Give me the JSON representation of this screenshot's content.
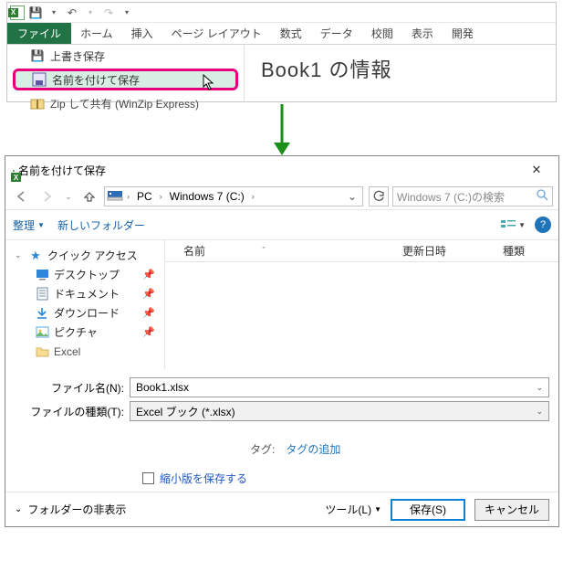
{
  "ribbon": {
    "tabs": {
      "file": "ファイル",
      "home": "ホーム",
      "insert": "挿入",
      "pagelayout": "ページ レイアウト",
      "formulas": "数式",
      "data": "データ",
      "review": "校閲",
      "view": "表示",
      "developer": "開発"
    }
  },
  "backstage": {
    "overwrite": "上書き保存",
    "saveas": "名前を付けて保存",
    "zip": "Zip して共有 (WinZip Express)",
    "info_title": "Book1 の情報"
  },
  "dialog": {
    "title": "名前を付けて保存",
    "breadcrumb": {
      "pc": "PC",
      "drive": "Windows 7 (C:)"
    },
    "search_placeholder": "Windows 7 (C:)の検索",
    "toolbar": {
      "organize": "整理",
      "newfolder": "新しいフォルダー"
    },
    "columns": {
      "name": "名前",
      "modified": "更新日時",
      "type": "種類"
    },
    "tree": {
      "quick": "クイック アクセス",
      "desktop": "デスクトップ",
      "documents": "ドキュメント",
      "downloads": "ダウンロード",
      "pictures": "ピクチャ",
      "excel": "Excel"
    },
    "filename_label": "ファイル名(N):",
    "filename_value": "Book1.xlsx",
    "filetype_label": "ファイルの種類(T):",
    "filetype_value": "Excel ブック (*.xlsx)",
    "tag_label": "タグ:",
    "tag_link": "タグの追加",
    "thumb_label": "縮小版を保存する",
    "hide_folders": "フォルダーの非表示",
    "tools": "ツール(L)",
    "save": "保存(S)",
    "cancel": "キャンセル"
  }
}
